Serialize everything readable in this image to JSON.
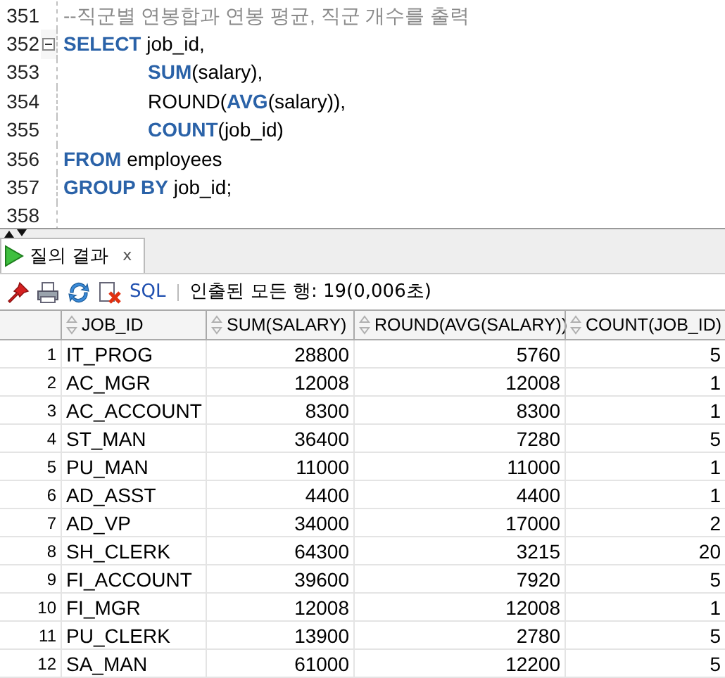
{
  "editor": {
    "lines": [
      {
        "number": "351",
        "foldable": false,
        "indented": false,
        "segments": [
          {
            "kind": "comment",
            "text": "--직군별 연봉합과 연봉 평균, 직군 개수를 출력"
          }
        ]
      },
      {
        "number": "352",
        "foldable": true,
        "indented": false,
        "segments": [
          {
            "kind": "keyword",
            "text": "SELECT"
          },
          {
            "kind": "plain",
            "text": " job_id,"
          }
        ]
      },
      {
        "number": "353",
        "foldable": false,
        "indented": true,
        "segments": [
          {
            "kind": "keyword",
            "text": "SUM"
          },
          {
            "kind": "plain",
            "text": "(salary),"
          }
        ]
      },
      {
        "number": "354",
        "foldable": false,
        "indented": true,
        "segments": [
          {
            "kind": "plain",
            "text": "ROUND("
          },
          {
            "kind": "keyword",
            "text": "AVG"
          },
          {
            "kind": "plain",
            "text": "(salary)),"
          }
        ]
      },
      {
        "number": "355",
        "foldable": false,
        "indented": true,
        "segments": [
          {
            "kind": "keyword",
            "text": "COUNT"
          },
          {
            "kind": "plain",
            "text": "(job_id)"
          }
        ]
      },
      {
        "number": "356",
        "foldable": false,
        "indented": false,
        "segments": [
          {
            "kind": "keyword",
            "text": "FROM"
          },
          {
            "kind": "plain",
            "text": " employees"
          }
        ]
      },
      {
        "number": "357",
        "foldable": false,
        "indented": false,
        "segments": [
          {
            "kind": "keyword",
            "text": "GROUP BY"
          },
          {
            "kind": "plain",
            "text": " job_id;"
          }
        ]
      },
      {
        "number": "358",
        "foldable": false
      }
    ]
  },
  "results_tab": {
    "label": "질의 결과",
    "close": "x",
    "selected": true
  },
  "toolbar": {
    "sql_link": "SQL",
    "status": "인출된 모든 행: 19(0,006초)"
  },
  "table": {
    "columns": [
      "JOB_ID",
      "SUM(SALARY)",
      "ROUND(AVG(SALARY))",
      "COUNT(JOB_ID)"
    ],
    "rows": [
      {
        "number": "1",
        "cells": [
          "IT_PROG",
          "28800",
          "5760",
          "5"
        ]
      },
      {
        "number": "2",
        "cells": [
          "AC_MGR",
          "12008",
          "12008",
          "1"
        ]
      },
      {
        "number": "3",
        "cells": [
          "AC_ACCOUNT",
          "8300",
          "8300",
          "1"
        ]
      },
      {
        "number": "4",
        "cells": [
          "ST_MAN",
          "36400",
          "7280",
          "5"
        ]
      },
      {
        "number": "5",
        "cells": [
          "PU_MAN",
          "11000",
          "11000",
          "1"
        ]
      },
      {
        "number": "6",
        "cells": [
          "AD_ASST",
          "4400",
          "4400",
          "1"
        ]
      },
      {
        "number": "7",
        "cells": [
          "AD_VP",
          "34000",
          "17000",
          "2"
        ]
      },
      {
        "number": "8",
        "cells": [
          "SH_CLERK",
          "64300",
          "3215",
          "20"
        ]
      },
      {
        "number": "9",
        "cells": [
          "FI_ACCOUNT",
          "39600",
          "7920",
          "5"
        ]
      },
      {
        "number": "10",
        "cells": [
          "FI_MGR",
          "12008",
          "12008",
          "1"
        ]
      },
      {
        "number": "11",
        "cells": [
          "PU_CLERK",
          "13900",
          "2780",
          "5"
        ]
      },
      {
        "number": "12",
        "cells": [
          "SA_MAN",
          "61000",
          "12200",
          "5"
        ]
      }
    ]
  }
}
